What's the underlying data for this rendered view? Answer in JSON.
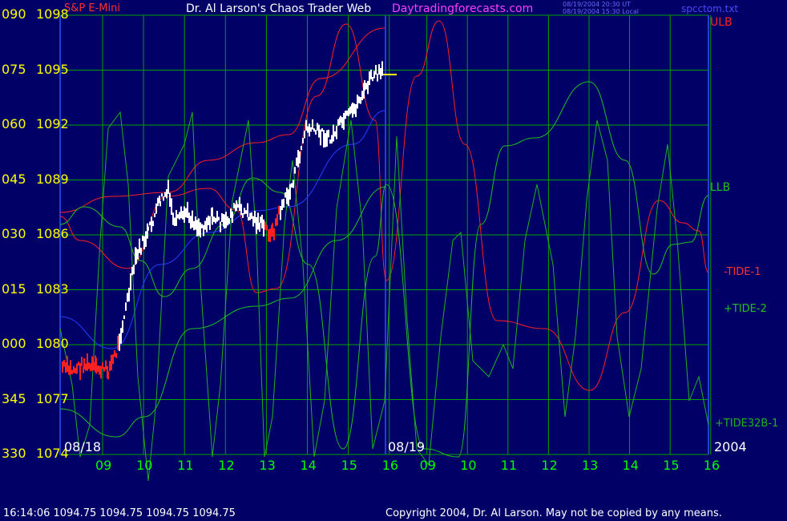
{
  "header": {
    "instrument": "S&P E-Mini",
    "title": "Dr. Al Larson's Chaos Trader Web",
    "site": "Daytradingforecasts.com",
    "time_ut": "08/19/2004 20:30 UT",
    "time_local": "08/19/2004 15:30 Local",
    "file": "spcctom.txt"
  },
  "left_axis": {
    "angle_labels": [
      "090",
      "075",
      "060",
      "045",
      "030",
      "015",
      "000",
      "345",
      "330"
    ],
    "price_labels": [
      "1098",
      "1095",
      "1092",
      "1089",
      "1086",
      "1083",
      "1080",
      "1077",
      "1074"
    ]
  },
  "x_axis": {
    "hour_labels": [
      "09",
      "10",
      "11",
      "12",
      "13",
      "14",
      "15",
      "16",
      "09",
      "10",
      "11",
      "12",
      "13",
      "14",
      "15",
      "16"
    ],
    "date_labels": [
      "08/18",
      "08/19"
    ],
    "year_label": "2004"
  },
  "right_labels": {
    "ulb": "ULB",
    "llb": "LLB",
    "tide1": "-TIDE-1",
    "tide2": "+TIDE-2",
    "tide32": "+TIDE32B-1"
  },
  "footer": {
    "quote": "16:14:06  1094.75 1094.75 1094.75 1094.75",
    "copyright": "Copyright 2004, Dr. Al Larson. May not be copied by any means."
  },
  "colors": {
    "background": "#000066",
    "grid": "#00a000",
    "price_bar": "#ffffff",
    "price_bar_low": "#ff2020",
    "ulb": "#ff2020",
    "llb": "#20c020",
    "tide": "#20b020",
    "envelope": "#2040ff",
    "last_price": "#ffff00"
  },
  "chart_data": {
    "type": "line",
    "title": "S&P E-Mini",
    "ylim": [
      1074,
      1098
    ],
    "y_ticks": [
      1098,
      1095,
      1092,
      1089,
      1086,
      1083,
      1080,
      1077,
      1074
    ],
    "x_unit": "hours (CT), 08/18 09:00 to 08/19 16:00, 2004",
    "series": [
      {
        "name": "S&P E-Mini",
        "style": "bars",
        "points": [
          [
            "08/18 08:30",
            1079.5
          ],
          [
            "08/18 09:00",
            1078.8
          ],
          [
            "08/18 09:30",
            1078.9
          ],
          [
            "08/18 09:45",
            1080.0
          ],
          [
            "08/18 10:00",
            1084.5
          ],
          [
            "08/18 10:15",
            1086.2
          ],
          [
            "08/18 10:30",
            1088.5
          ],
          [
            "08/18 10:45",
            1086.5
          ],
          [
            "08/18 11:00",
            1086.0
          ],
          [
            "08/18 11:30",
            1086.8
          ],
          [
            "08/18 12:00",
            1086.1
          ],
          [
            "08/18 12:30",
            1087.3
          ],
          [
            "08/18 13:00",
            1086.5
          ],
          [
            "08/18 13:30",
            1086.0
          ],
          [
            "08/18 13:45",
            1088.0
          ],
          [
            "08/18 14:00",
            1090.5
          ],
          [
            "08/18 14:30",
            1091.5
          ],
          [
            "08/18 15:00",
            1091.0
          ],
          [
            "08/18 15:30",
            1093.0
          ],
          [
            "08/18 15:45",
            1094.6
          ],
          [
            "08/18 16:00",
            1094.75
          ]
        ]
      },
      {
        "name": "ULB"
      },
      {
        "name": "LLB"
      },
      {
        "name": "-TIDE-1"
      },
      {
        "name": "+TIDE-2"
      },
      {
        "name": "+TIDE32B-1"
      }
    ],
    "last_price": 1094.75,
    "grid": true,
    "legend": "right"
  }
}
